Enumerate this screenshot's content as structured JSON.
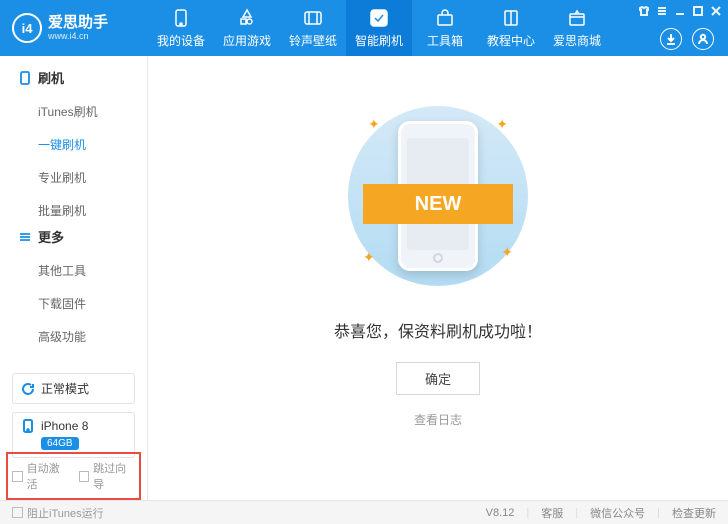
{
  "brand": {
    "name": "爱思助手",
    "url": "www.i4.cn",
    "logo": "i4"
  },
  "nav": [
    {
      "icon": "device",
      "label": "我的设备"
    },
    {
      "icon": "apps",
      "label": "应用游戏"
    },
    {
      "icon": "ringtone",
      "label": "铃声壁纸"
    },
    {
      "icon": "flash",
      "label": "智能刷机",
      "active": true
    },
    {
      "icon": "toolbox",
      "label": "工具箱"
    },
    {
      "icon": "book",
      "label": "教程中心"
    },
    {
      "icon": "cart",
      "label": "爱思商城"
    }
  ],
  "sidebar": {
    "groups": [
      {
        "title": "刷机",
        "icon": "device",
        "items": [
          {
            "label": "iTunes刷机"
          },
          {
            "label": "一键刷机",
            "active": true
          },
          {
            "label": "专业刷机"
          },
          {
            "label": "批量刷机"
          }
        ]
      },
      {
        "title": "更多",
        "icon": "more",
        "items": [
          {
            "label": "其他工具"
          },
          {
            "label": "下载固件"
          },
          {
            "label": "高级功能"
          }
        ]
      }
    ],
    "mode": "正常模式",
    "device": {
      "name": "iPhone 8",
      "storage": "64GB"
    },
    "checks": [
      {
        "label": "自动激活"
      },
      {
        "label": "跳过向导"
      }
    ]
  },
  "content": {
    "ribbon": "NEW",
    "message": "恭喜您，保资料刷机成功啦！",
    "ok": "确定",
    "log": "查看日志"
  },
  "status": {
    "left": "阻止iTunes运行",
    "version": "V8.12",
    "links": [
      "客服",
      "微信公众号",
      "检查更新"
    ]
  }
}
